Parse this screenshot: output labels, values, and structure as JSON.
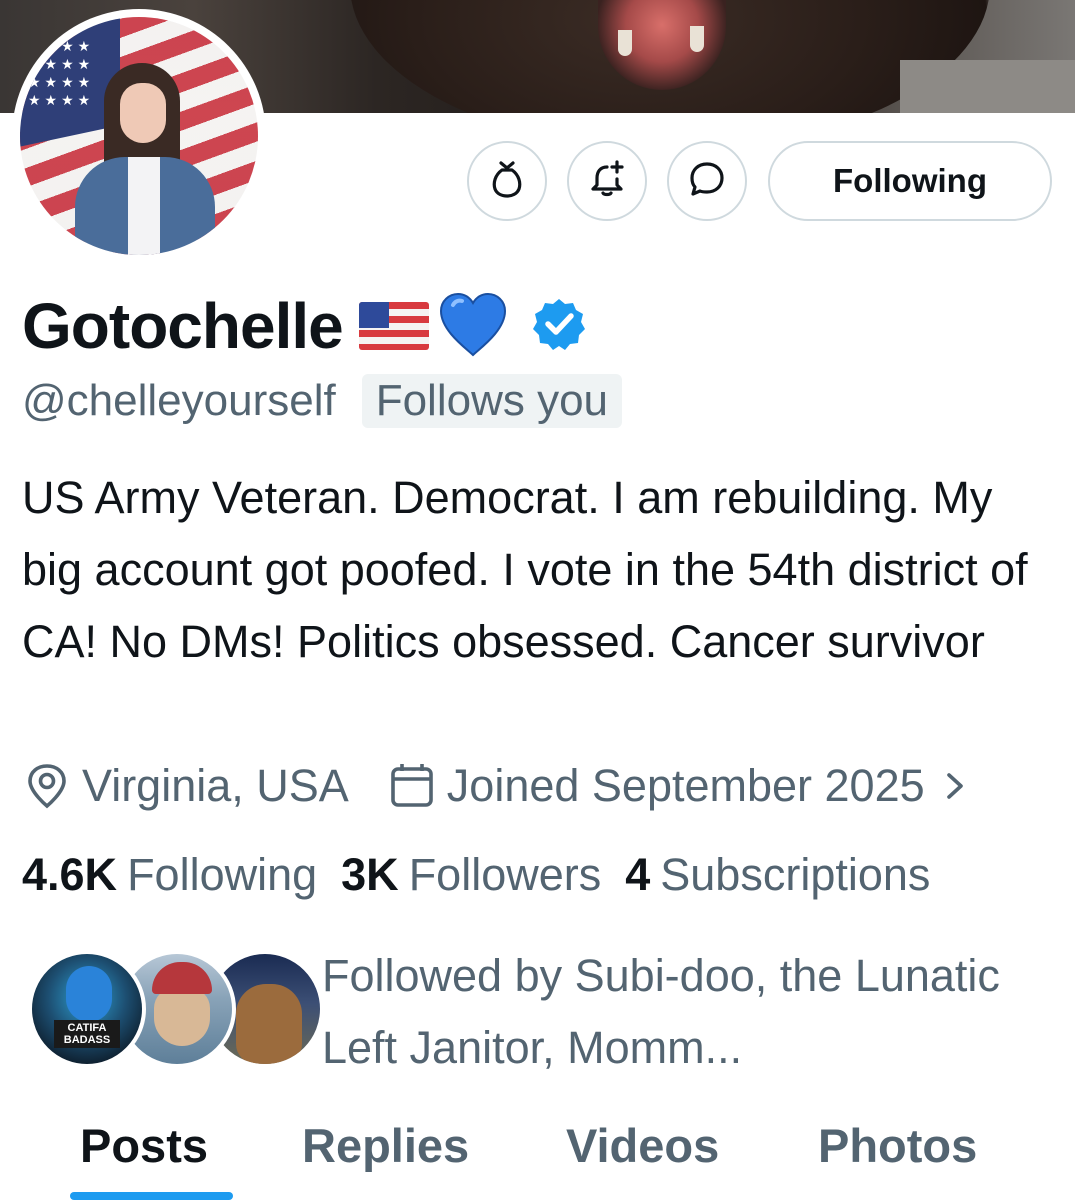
{
  "profile": {
    "name": "Gotochelle",
    "handle": "@chelleyourself",
    "follows_you": "Follows you",
    "bio": "US Army Veteran. Democrat. I am rebuilding. My big account got poofed. I vote in the 54th district of CA! No DMs! Politics obsessed. Cancer survivor",
    "location": "Virginia, USA",
    "joined": "Joined September 2025",
    "verified_color": "#1d9bf0",
    "name_emoji": [
      "us-flag",
      "blue-heart"
    ]
  },
  "actions": {
    "following_label": "Following",
    "icons": [
      "bag-icon",
      "notification-bell-plus-icon",
      "message-icon"
    ]
  },
  "stats": {
    "following_count": "4.6K",
    "following_label": "Following",
    "followers_count": "3K",
    "followers_label": "Followers",
    "subscriptions_count": "4",
    "subscriptions_label": "Subscriptions"
  },
  "followed_by": {
    "text": "Followed by Subi-doo, the Lunatic Left Janitor, Momm...",
    "avatar_badge": "CATIFA BADASS"
  },
  "tabs": [
    {
      "label": "Posts",
      "active": true
    },
    {
      "label": "Replies",
      "active": false
    },
    {
      "label": "Videos",
      "active": false
    },
    {
      "label": "Photos",
      "active": false
    }
  ],
  "colors": {
    "accent": "#1d9bf0",
    "text_primary": "#0f1419",
    "text_secondary": "#536471",
    "border": "#cfd9de"
  }
}
